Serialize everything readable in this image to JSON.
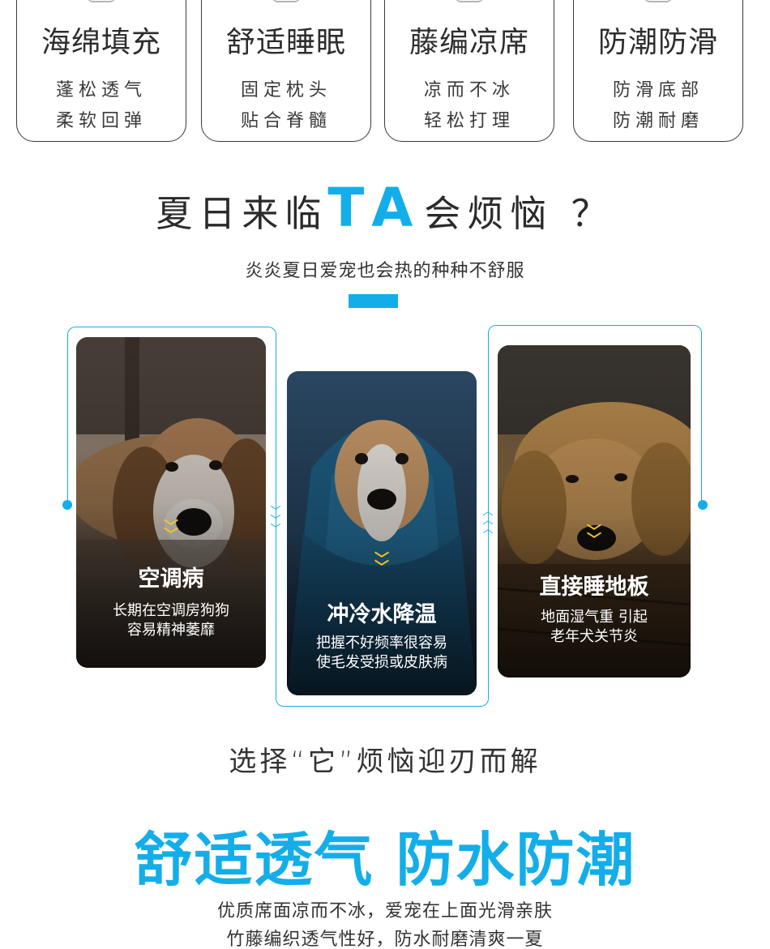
{
  "features": [
    {
      "title": "海绵填充",
      "line1": "蓬松透气",
      "line2": "柔软回弹"
    },
    {
      "title": "舒适睡眠",
      "line1": "固定枕头",
      "line2": "贴合脊髓"
    },
    {
      "title": "藤编凉席",
      "line1": "凉而不冰",
      "line2": "轻松打理"
    },
    {
      "title": "防潮防滑",
      "line1": "防滑底部",
      "line2": "防潮耐磨"
    }
  ],
  "heading": {
    "part1": "夏日来临",
    "highlight": "TA",
    "part2": "会烦恼 ？",
    "sub": "炎炎夏日爱宠也会热的种种不舒服"
  },
  "problems": [
    {
      "title": "空调病",
      "desc1": "长期在空调房狗狗",
      "desc2": "容易精神萎靡"
    },
    {
      "title": "冲冷水降温",
      "desc1": "把握不好频率很容易",
      "desc2": "使毛发受损或皮肤病"
    },
    {
      "title": "直接睡地板",
      "desc1": "地面湿气重 引起",
      "desc2": "老年犬关节炎"
    }
  ],
  "solution": {
    "heading": "选择“它”烦恼迎刃而解",
    "slogan": "舒适透气 防水防潮",
    "line1": "优质席面凉而不冰，爱宠在上面光滑亲肤",
    "line2": "竹藤编织透气性好，防水耐磨清爽一夏"
  },
  "colors": {
    "accent": "#13aee9",
    "chevron": "#f6c525",
    "text": "#2a2a2a"
  }
}
